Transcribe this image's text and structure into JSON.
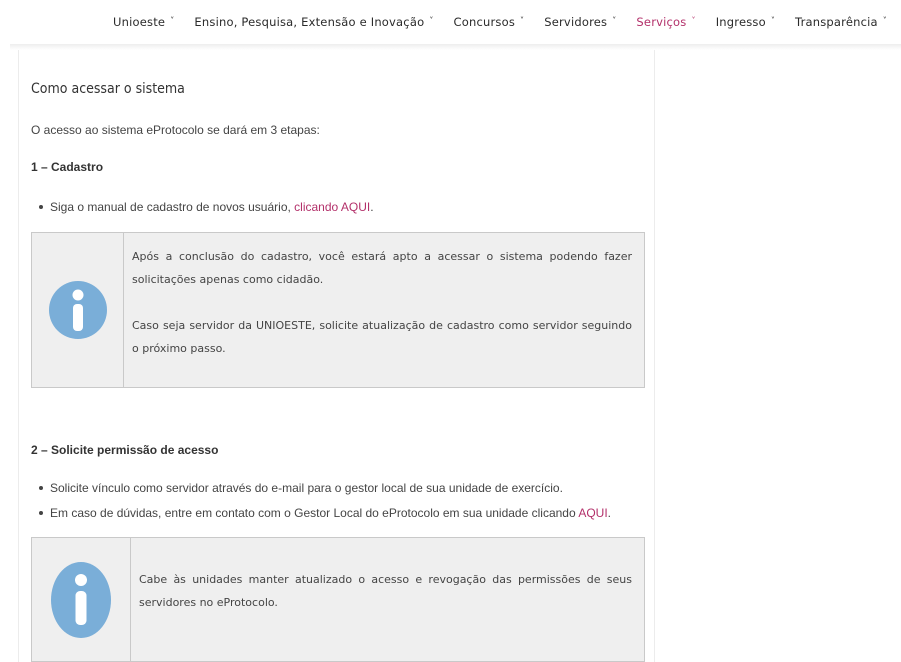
{
  "nav": {
    "items": [
      {
        "label": "Unioeste",
        "active": false
      },
      {
        "label": "Ensino, Pesquisa, Extensão e Inovação",
        "active": false
      },
      {
        "label": "Concursos",
        "active": false
      },
      {
        "label": "Servidores",
        "active": false
      },
      {
        "label": "Serviços",
        "active": true
      },
      {
        "label": "Ingresso",
        "active": false
      },
      {
        "label": "Transparência",
        "active": false
      }
    ],
    "chevron": "˅"
  },
  "content": {
    "title": "Como acessar o sistema",
    "intro": "O acesso ao sistema eProtocolo se dará em 3 etapas:",
    "step1": {
      "title": "1 – Cadastro",
      "bullet_text": "Siga o manual de cadastro de novos usuário, ",
      "bullet_link": "clicando AQUI",
      "bullet_end": ".",
      "info_p1": "Após a conclusão do cadastro, você estará apto a acessar o sistema podendo fazer solicitações apenas como cidadão.",
      "info_p2": "Caso seja servidor da UNIOESTE, solicite atualização de cadastro como servidor seguindo o próximo passo."
    },
    "step2": {
      "title": "2 – Solicite permissão de acesso",
      "bullet1": "Solicite vínculo como servidor através do e-mail para o gestor local de sua unidade de exercício.",
      "bullet2_text": "Em caso de dúvidas, entre em contato com o Gestor Local do eProtocolo em sua unidade clicando ",
      "bullet2_link": "AQUI",
      "bullet2_end": ".",
      "info_p1": "Cabe às unidades manter atualizado o acesso e revogação das permissões de seus servidores no eProtocolo."
    }
  },
  "colors": {
    "accent": "#b3306a",
    "info_icon": "#7aaed8",
    "box_bg": "#efefef"
  },
  "icons": {
    "info": "info-icon"
  }
}
